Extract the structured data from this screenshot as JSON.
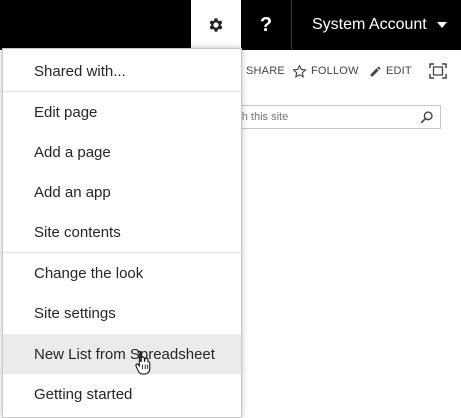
{
  "suite_bar": {
    "settings_icon": "gear-icon",
    "help_label": "?",
    "account_name": "System Account"
  },
  "page_actions": {
    "share_label": "SHARE",
    "follow_label": "FOLLOW",
    "edit_label": "EDIT"
  },
  "search": {
    "placeholder": "Search this site"
  },
  "menu": {
    "items": [
      {
        "label": "Shared with..."
      },
      {
        "label": "Edit page"
      },
      {
        "label": "Add a page"
      },
      {
        "label": "Add an app"
      },
      {
        "label": "Site contents"
      },
      {
        "label": "Change the look"
      },
      {
        "label": "Site settings"
      },
      {
        "label": "New List from Spreadsheet"
      },
      {
        "label": "Getting started"
      }
    ],
    "hovered_item": "New List from Spreadsheet"
  },
  "colors": {
    "suite_bar": "#000000",
    "menu_hover": "#ebebeb",
    "text": "#262626"
  }
}
